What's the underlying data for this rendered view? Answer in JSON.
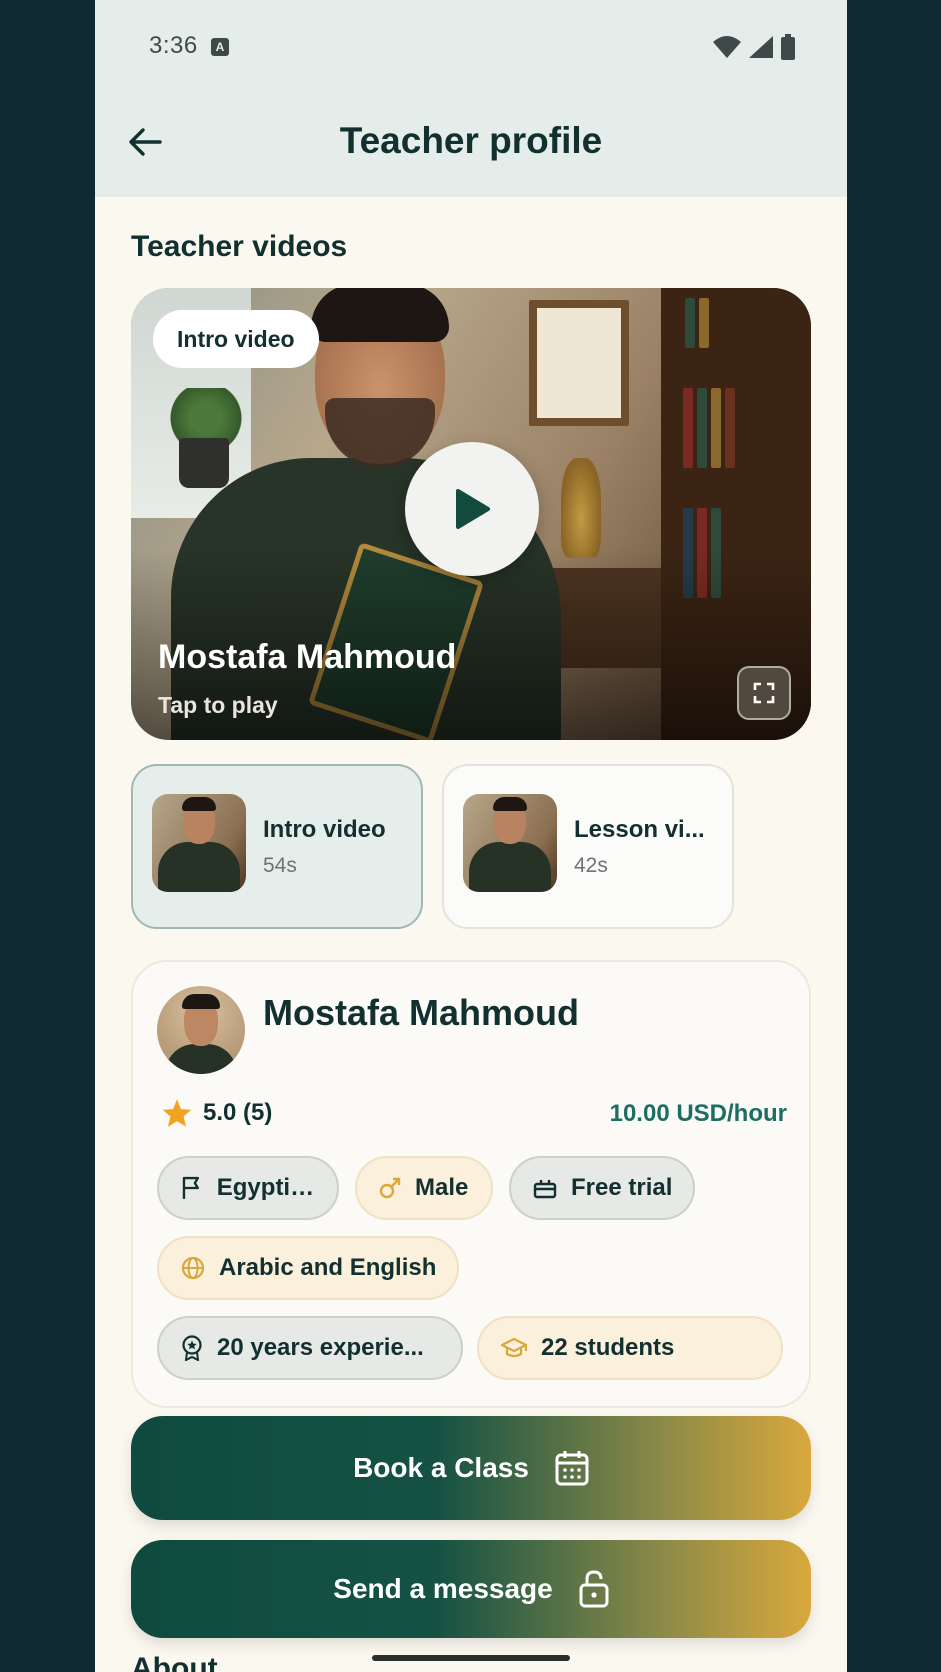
{
  "status_bar": {
    "time": "3:36"
  },
  "app_bar": {
    "title": "Teacher profile"
  },
  "videos": {
    "section_title": "Teacher videos",
    "hero": {
      "chip": "Intro video",
      "name": "Mostafa Mahmoud",
      "subtitle": "Tap to play"
    },
    "items": [
      {
        "title": "Intro video",
        "duration": "54s",
        "active": true
      },
      {
        "title": "Lesson vi...",
        "duration": "42s",
        "active": false
      }
    ]
  },
  "profile": {
    "name": "Mostafa Mahmoud",
    "rating": "5.0 (5)",
    "price": "10.00 USD/hour",
    "chips": [
      {
        "label": "Egyptian",
        "icon": "flag-icon",
        "style": "grey"
      },
      {
        "label": "Male",
        "icon": "male-icon",
        "style": "gold"
      },
      {
        "label": "Free trial",
        "icon": "gift-icon",
        "style": "grey"
      },
      {
        "label": "Arabic and English",
        "icon": "globe-icon",
        "style": "gold"
      },
      {
        "label": "20 years experie...",
        "icon": "award-icon",
        "style": "grey"
      },
      {
        "label": "22 students",
        "icon": "graduation-cap-icon",
        "style": "gold"
      }
    ]
  },
  "actions": {
    "book": "Book a Class",
    "message": "Send a message"
  },
  "about_title": "About",
  "colors": {
    "primary_dark": "#0f4a3e",
    "accent_gold": "#d9a83c",
    "text_dark": "#12302f",
    "price_teal": "#1c6d63",
    "star": "#f2a322"
  }
}
